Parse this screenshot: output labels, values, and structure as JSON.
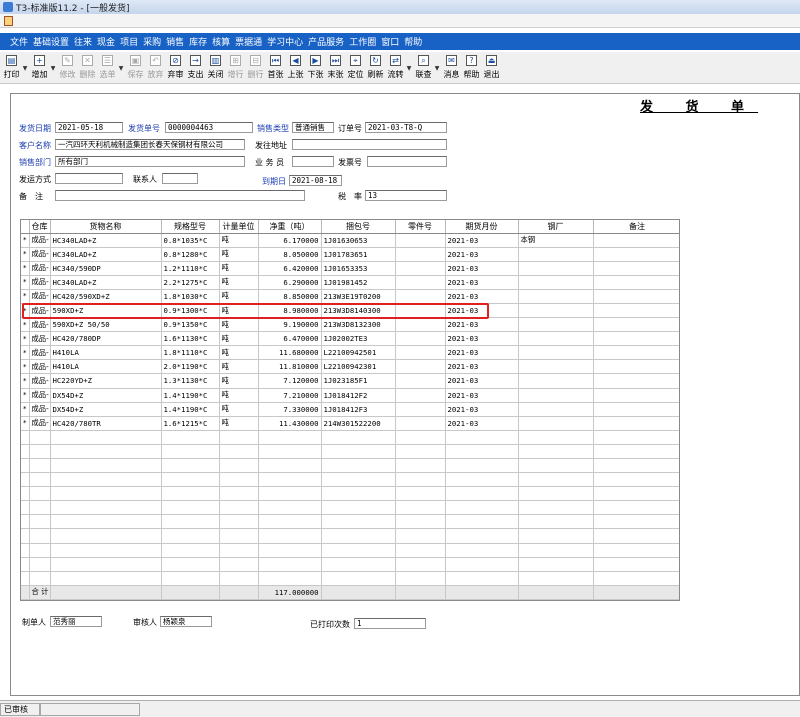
{
  "window": {
    "title": "T3-标准版11.2 - [一般发货]"
  },
  "menu": [
    "文件",
    "基础设置",
    "往来",
    "现金",
    "项目",
    "采购",
    "销售",
    "库存",
    "核算",
    "票据通",
    "学习中心",
    "产品服务",
    "工作圈",
    "窗口",
    "帮助"
  ],
  "toolbar": [
    {
      "label": "打印",
      "icon": "printer-icon",
      "glyph": "▤",
      "enabled": true,
      "dropdown": true
    },
    {
      "label": "增加",
      "icon": "add-icon",
      "glyph": "+",
      "enabled": true,
      "dropdown": true
    },
    {
      "label": "修改",
      "icon": "edit-icon",
      "glyph": "✎",
      "enabled": false
    },
    {
      "label": "删除",
      "icon": "delete-icon",
      "glyph": "✕",
      "enabled": false
    },
    {
      "label": "选单",
      "icon": "select-doc-icon",
      "glyph": "☰",
      "enabled": false,
      "dropdown": true
    },
    {
      "label": "保存",
      "icon": "save-icon",
      "glyph": "▣",
      "enabled": false
    },
    {
      "label": "放弃",
      "icon": "undo-icon",
      "glyph": "↶",
      "enabled": false
    },
    {
      "label": "弃审",
      "icon": "unaudit-icon",
      "glyph": "⊘",
      "enabled": true
    },
    {
      "label": "支出",
      "icon": "payout-icon",
      "glyph": "→",
      "enabled": true
    },
    {
      "label": "关闭",
      "icon": "close-doc-icon",
      "glyph": "▥",
      "enabled": true
    },
    {
      "label": "增行",
      "icon": "add-row-icon",
      "glyph": "⊞",
      "enabled": false
    },
    {
      "label": "删行",
      "icon": "delete-row-icon",
      "glyph": "⊟",
      "enabled": false
    },
    {
      "label": "首张",
      "icon": "first-record-icon",
      "glyph": "⏮",
      "enabled": true
    },
    {
      "label": "上张",
      "icon": "prev-record-icon",
      "glyph": "◀",
      "enabled": true
    },
    {
      "label": "下张",
      "icon": "next-record-icon",
      "glyph": "▶",
      "enabled": true
    },
    {
      "label": "末张",
      "icon": "last-record-icon",
      "glyph": "⏭",
      "enabled": true
    },
    {
      "label": "定位",
      "icon": "locate-icon",
      "glyph": "⌖",
      "enabled": true
    },
    {
      "label": "刷新",
      "icon": "refresh-icon",
      "glyph": "↻",
      "enabled": true
    },
    {
      "label": "流转",
      "icon": "flow-icon",
      "glyph": "⇄",
      "enabled": true,
      "dropdown": true
    },
    {
      "label": "联查",
      "icon": "query-icon",
      "glyph": "⌕",
      "enabled": true,
      "dropdown": true
    },
    {
      "label": "消息",
      "icon": "message-icon",
      "glyph": "✉",
      "enabled": true
    },
    {
      "label": "帮助",
      "icon": "help-icon",
      "glyph": "?",
      "enabled": true
    },
    {
      "label": "退出",
      "icon": "exit-icon",
      "glyph": "⏏",
      "enabled": true
    }
  ],
  "doc": {
    "title": "发 货 单",
    "fields": {
      "ship_date_label": "发货日期",
      "ship_date": "2021-05-18",
      "ship_no_label": "发货单号",
      "ship_no": "0000004463",
      "sales_type_label": "销售类型",
      "sales_type": "普通销售",
      "order_no_label": "订单号",
      "order_no": "2021-03-T8-Q",
      "customer_label": "客户名称",
      "customer": "一汽四环天利机械制造集团长春天保钢材有限公司",
      "ship_addr_label": "发往地址",
      "ship_addr": "",
      "dept_label": "销售部门",
      "dept": "所有部门",
      "salesman_label": "业 务 员",
      "salesman": "",
      "invoice_no_label": "发票号",
      "invoice_no": "",
      "ship_method_label": "发运方式",
      "ship_method": "",
      "contact_label": "联系人",
      "contact": "",
      "due_date_label": "到期日",
      "due_date": "2021-08-18",
      "remark_label": "备　注",
      "remark": "",
      "tax_rate_label": "税　率",
      "tax_rate": "13"
    },
    "columns": [
      "仓库",
      "货物名称",
      "规格型号",
      "计量单位",
      "净重（吨）",
      "捆包号",
      "零件号",
      "期货月份",
      "钢厂",
      "备注"
    ],
    "rows": [
      {
        "mark": "*",
        "warehouse": "成品-",
        "name": "HC340LAD+Z",
        "spec": "0.8*1035*C",
        "unit": "吨",
        "weight": "6.170000",
        "bundle": "1J01630653",
        "part": "",
        "month": "2021-03",
        "mill": "本钢",
        "note": ""
      },
      {
        "mark": "*",
        "warehouse": "成品-",
        "name": "HC340LAD+Z",
        "spec": "0.8*1280*C",
        "unit": "吨",
        "weight": "8.050000",
        "bundle": "1J01783651",
        "part": "",
        "month": "2021-03",
        "mill": "",
        "note": ""
      },
      {
        "mark": "*",
        "warehouse": "成品-",
        "name": "HC340/590DP",
        "spec": "1.2*1110*C",
        "unit": "吨",
        "weight": "6.420000",
        "bundle": "1J01653353",
        "part": "",
        "month": "2021-03",
        "mill": "",
        "note": ""
      },
      {
        "mark": "*",
        "warehouse": "成品-",
        "name": "HC340LAD+Z",
        "spec": "2.2*1275*C",
        "unit": "吨",
        "weight": "6.290000",
        "bundle": "1J01981452",
        "part": "",
        "month": "2021-03",
        "mill": "",
        "note": ""
      },
      {
        "mark": "*",
        "warehouse": "成品-",
        "name": "HC420/590XD+Z",
        "spec": "1.8*1030*C",
        "unit": "吨",
        "weight": "8.850000",
        "bundle": "213W3E19T0200",
        "part": "",
        "month": "2021-03",
        "mill": "",
        "note": ""
      },
      {
        "mark": "*",
        "warehouse": "成品-",
        "name": "590XD+Z",
        "spec": "0.9*1300*C",
        "unit": "吨",
        "weight": "8.980000",
        "bundle": "213W3D8140300",
        "part": "",
        "month": "2021-03",
        "mill": "",
        "note": ""
      },
      {
        "mark": "*",
        "warehouse": "成品-",
        "name": "590XD+Z 50/50",
        "spec": "0.9*1350*C",
        "unit": "吨",
        "weight": "9.190000",
        "bundle": "213W3D8132300",
        "part": "",
        "month": "2021-03",
        "mill": "",
        "note": ""
      },
      {
        "mark": "*",
        "warehouse": "成品-",
        "name": "HC420/780DP",
        "spec": "1.6*1130*C",
        "unit": "吨",
        "weight": "6.470000",
        "bundle": "1J02002TE3",
        "part": "",
        "month": "2021-03",
        "mill": "",
        "note": ""
      },
      {
        "mark": "*",
        "warehouse": "成品-",
        "name": "H410LA",
        "spec": "1.8*1110*C",
        "unit": "吨",
        "weight": "11.680000",
        "bundle": "L22100942501",
        "part": "",
        "month": "2021-03",
        "mill": "",
        "note": ""
      },
      {
        "mark": "*",
        "warehouse": "成品-",
        "name": "H410LA",
        "spec": "2.0*1190*C",
        "unit": "吨",
        "weight": "11.810000",
        "bundle": "L22100942301",
        "part": "",
        "month": "2021-03",
        "mill": "",
        "note": ""
      },
      {
        "mark": "*",
        "warehouse": "成品-",
        "name": "HC220YD+Z",
        "spec": "1.3*1130*C",
        "unit": "吨",
        "weight": "7.120000",
        "bundle": "1J023185F1",
        "part": "",
        "month": "2021-03",
        "mill": "",
        "note": ""
      },
      {
        "mark": "*",
        "warehouse": "成品-",
        "name": "DX54D+Z",
        "spec": "1.4*1190*C",
        "unit": "吨",
        "weight": "7.210000",
        "bundle": "1J018412F2",
        "part": "",
        "month": "2021-03",
        "mill": "",
        "note": ""
      },
      {
        "mark": "*",
        "warehouse": "成品-",
        "name": "DX54D+Z",
        "spec": "1.4*1190*C",
        "unit": "吨",
        "weight": "7.330000",
        "bundle": "1J018412F3",
        "part": "",
        "month": "2021-03",
        "mill": "",
        "note": ""
      },
      {
        "mark": "*",
        "warehouse": "成品-",
        "name": "HC420/780TR",
        "spec": "1.6*1215*C",
        "unit": "吨",
        "weight": "11.430000",
        "bundle": "214W301522200",
        "part": "",
        "month": "2021-03",
        "mill": "",
        "note": ""
      }
    ],
    "total_label": "合 计",
    "total_weight": "117.000000",
    "footer": {
      "maker_label": "制单人",
      "maker": "范秀丽",
      "auditor_label": "审核人",
      "auditor": "杨颖泉",
      "printed_label": "已打印次数",
      "printed": "1"
    }
  },
  "status": {
    "text": "已审核"
  },
  "accent_color": "#1862c6",
  "highlight_color": "#e02020"
}
